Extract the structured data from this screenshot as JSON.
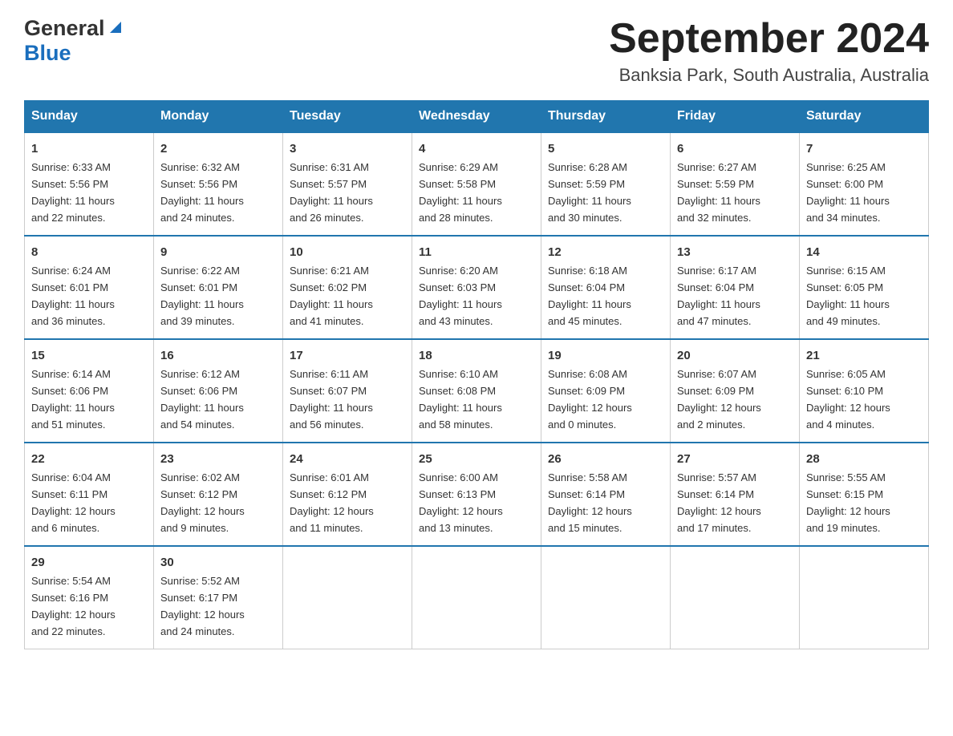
{
  "header": {
    "logo_general": "General",
    "logo_blue": "Blue",
    "title": "September 2024",
    "subtitle": "Banksia Park, South Australia, Australia"
  },
  "columns": [
    "Sunday",
    "Monday",
    "Tuesday",
    "Wednesday",
    "Thursday",
    "Friday",
    "Saturday"
  ],
  "weeks": [
    [
      {
        "day": "1",
        "info": "Sunrise: 6:33 AM\nSunset: 5:56 PM\nDaylight: 11 hours\nand 22 minutes."
      },
      {
        "day": "2",
        "info": "Sunrise: 6:32 AM\nSunset: 5:56 PM\nDaylight: 11 hours\nand 24 minutes."
      },
      {
        "day": "3",
        "info": "Sunrise: 6:31 AM\nSunset: 5:57 PM\nDaylight: 11 hours\nand 26 minutes."
      },
      {
        "day": "4",
        "info": "Sunrise: 6:29 AM\nSunset: 5:58 PM\nDaylight: 11 hours\nand 28 minutes."
      },
      {
        "day": "5",
        "info": "Sunrise: 6:28 AM\nSunset: 5:59 PM\nDaylight: 11 hours\nand 30 minutes."
      },
      {
        "day": "6",
        "info": "Sunrise: 6:27 AM\nSunset: 5:59 PM\nDaylight: 11 hours\nand 32 minutes."
      },
      {
        "day": "7",
        "info": "Sunrise: 6:25 AM\nSunset: 6:00 PM\nDaylight: 11 hours\nand 34 minutes."
      }
    ],
    [
      {
        "day": "8",
        "info": "Sunrise: 6:24 AM\nSunset: 6:01 PM\nDaylight: 11 hours\nand 36 minutes."
      },
      {
        "day": "9",
        "info": "Sunrise: 6:22 AM\nSunset: 6:01 PM\nDaylight: 11 hours\nand 39 minutes."
      },
      {
        "day": "10",
        "info": "Sunrise: 6:21 AM\nSunset: 6:02 PM\nDaylight: 11 hours\nand 41 minutes."
      },
      {
        "day": "11",
        "info": "Sunrise: 6:20 AM\nSunset: 6:03 PM\nDaylight: 11 hours\nand 43 minutes."
      },
      {
        "day": "12",
        "info": "Sunrise: 6:18 AM\nSunset: 6:04 PM\nDaylight: 11 hours\nand 45 minutes."
      },
      {
        "day": "13",
        "info": "Sunrise: 6:17 AM\nSunset: 6:04 PM\nDaylight: 11 hours\nand 47 minutes."
      },
      {
        "day": "14",
        "info": "Sunrise: 6:15 AM\nSunset: 6:05 PM\nDaylight: 11 hours\nand 49 minutes."
      }
    ],
    [
      {
        "day": "15",
        "info": "Sunrise: 6:14 AM\nSunset: 6:06 PM\nDaylight: 11 hours\nand 51 minutes."
      },
      {
        "day": "16",
        "info": "Sunrise: 6:12 AM\nSunset: 6:06 PM\nDaylight: 11 hours\nand 54 minutes."
      },
      {
        "day": "17",
        "info": "Sunrise: 6:11 AM\nSunset: 6:07 PM\nDaylight: 11 hours\nand 56 minutes."
      },
      {
        "day": "18",
        "info": "Sunrise: 6:10 AM\nSunset: 6:08 PM\nDaylight: 11 hours\nand 58 minutes."
      },
      {
        "day": "19",
        "info": "Sunrise: 6:08 AM\nSunset: 6:09 PM\nDaylight: 12 hours\nand 0 minutes."
      },
      {
        "day": "20",
        "info": "Sunrise: 6:07 AM\nSunset: 6:09 PM\nDaylight: 12 hours\nand 2 minutes."
      },
      {
        "day": "21",
        "info": "Sunrise: 6:05 AM\nSunset: 6:10 PM\nDaylight: 12 hours\nand 4 minutes."
      }
    ],
    [
      {
        "day": "22",
        "info": "Sunrise: 6:04 AM\nSunset: 6:11 PM\nDaylight: 12 hours\nand 6 minutes."
      },
      {
        "day": "23",
        "info": "Sunrise: 6:02 AM\nSunset: 6:12 PM\nDaylight: 12 hours\nand 9 minutes."
      },
      {
        "day": "24",
        "info": "Sunrise: 6:01 AM\nSunset: 6:12 PM\nDaylight: 12 hours\nand 11 minutes."
      },
      {
        "day": "25",
        "info": "Sunrise: 6:00 AM\nSunset: 6:13 PM\nDaylight: 12 hours\nand 13 minutes."
      },
      {
        "day": "26",
        "info": "Sunrise: 5:58 AM\nSunset: 6:14 PM\nDaylight: 12 hours\nand 15 minutes."
      },
      {
        "day": "27",
        "info": "Sunrise: 5:57 AM\nSunset: 6:14 PM\nDaylight: 12 hours\nand 17 minutes."
      },
      {
        "day": "28",
        "info": "Sunrise: 5:55 AM\nSunset: 6:15 PM\nDaylight: 12 hours\nand 19 minutes."
      }
    ],
    [
      {
        "day": "29",
        "info": "Sunrise: 5:54 AM\nSunset: 6:16 PM\nDaylight: 12 hours\nand 22 minutes."
      },
      {
        "day": "30",
        "info": "Sunrise: 5:52 AM\nSunset: 6:17 PM\nDaylight: 12 hours\nand 24 minutes."
      },
      {
        "day": "",
        "info": ""
      },
      {
        "day": "",
        "info": ""
      },
      {
        "day": "",
        "info": ""
      },
      {
        "day": "",
        "info": ""
      },
      {
        "day": "",
        "info": ""
      }
    ]
  ]
}
